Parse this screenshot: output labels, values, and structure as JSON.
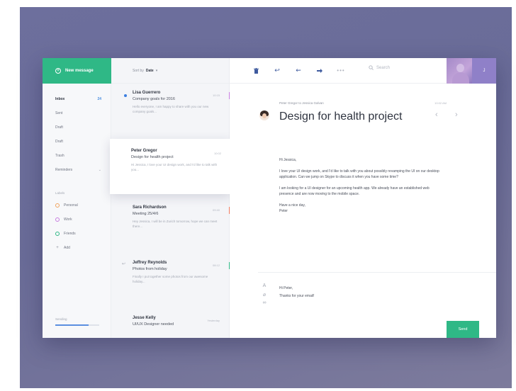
{
  "sidebar": {
    "new_message_label": "New message",
    "folders": [
      {
        "label": "Inbox",
        "count": "24"
      },
      {
        "label": "Sent",
        "count": ""
      },
      {
        "label": "Draft",
        "count": ""
      },
      {
        "label": "Draft",
        "count": ""
      },
      {
        "label": "Trash",
        "count": ""
      },
      {
        "label": "Reminders",
        "count": ""
      }
    ],
    "labels_heading": "Labels",
    "labels": [
      {
        "label": "Personal",
        "color": "#f0a35e"
      },
      {
        "label": "Work",
        "color": "#c77ce0"
      },
      {
        "label": "Friends",
        "color": "#2fb886"
      }
    ],
    "add_label": "Add",
    "sending_label": "Sending",
    "sending_progress": 0.75
  },
  "list": {
    "sort_prefix": "Sort by",
    "sort_value": "Date",
    "messages": [
      {
        "name": "Lisa Guerrero",
        "subject": "Company goals for 2016",
        "preview": "Hello everyone, I am happy to share with you our new company goals...",
        "time": "10:15",
        "tag_color": "#c77ce0",
        "unread": true
      },
      {
        "name": "Peter Gregor",
        "subject": "Design for health project",
        "preview": "Hi Jessica, I love your UI design work, and I'd like to talk with you...",
        "time": "10:02",
        "tag_color": "",
        "active": true
      },
      {
        "name": "Sara Richardson",
        "subject": "Meeting 25/4/6",
        "preview": "Hey Jessica, I will be in Zurich tomorrow, hope we can meet there...",
        "time": "09:40",
        "tag_color": "#f07a5e"
      },
      {
        "name": "Jeffrey Reynolds",
        "subject": "Photos from holiday",
        "preview": "Finally I put together some photos from our awesome holiday...",
        "time": "08:12",
        "tag_color": "#2fb886",
        "replied": true
      },
      {
        "name": "Jesse Kelly",
        "subject": "UI/UX Designer needed",
        "preview": "",
        "time": "Yesterday",
        "tag_color": ""
      }
    ]
  },
  "toolbar": {
    "search_placeholder": "Search",
    "user_initial": "J"
  },
  "email": {
    "meta": "Peter Gregor to Jessica Galvan",
    "date": "10:02 AM",
    "title": "Design for health project",
    "greeting": "Hi Jessica,",
    "paragraph1": "I love your UI design work, and I'd like to talk with you about possibly revamping the UI on our desktop application. Can we jump on Skype to discuss it when you have some time?",
    "paragraph2": "I am looking for a UI designer for an upcoming health app. We already have an established web presence and are now moving to the mobile space.",
    "signoff1": "Have a nice day,",
    "signoff2": "Peter",
    "reply_line1": "Hi Peter,",
    "reply_line2": "Thanks for your email!",
    "send_label": "Send"
  },
  "colors": {
    "accent_green": "#2fb886",
    "link_blue": "#3b7ee0",
    "background": "#6d6f9d"
  }
}
